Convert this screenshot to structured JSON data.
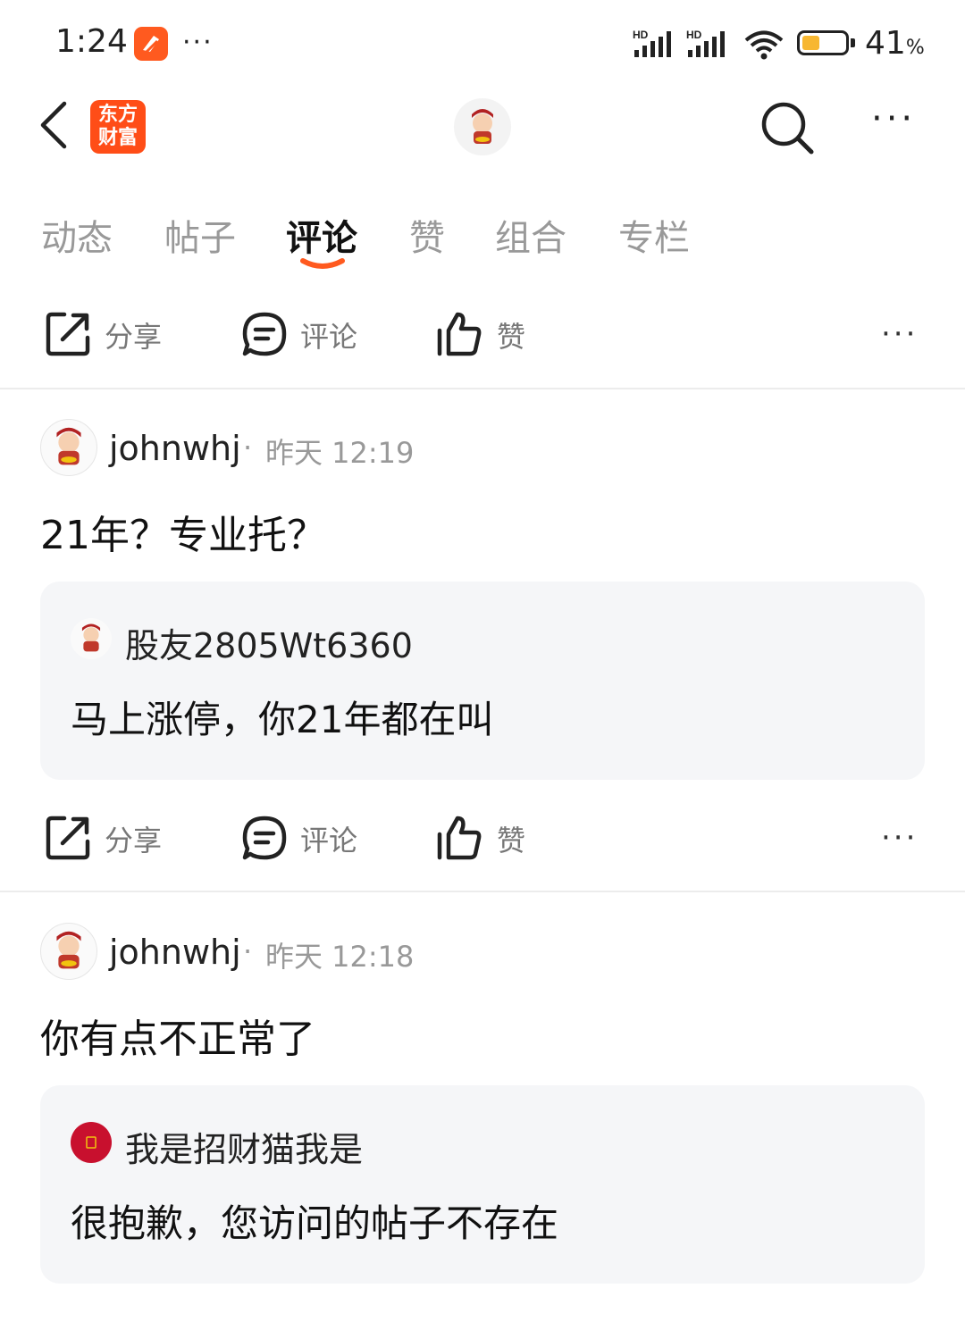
{
  "status_bar": {
    "time": "1:24",
    "more": "···",
    "battery_percent": "41",
    "battery_unit": "%",
    "battery_level": 0.41,
    "signal_label": "HD"
  },
  "header": {
    "logo_line1": "东方",
    "logo_line2": "财富",
    "more": "···"
  },
  "tabs": [
    {
      "label": "动态"
    },
    {
      "label": "帖子"
    },
    {
      "label": "评论",
      "active": true
    },
    {
      "label": "赞"
    },
    {
      "label": "组合"
    },
    {
      "label": "专栏"
    }
  ],
  "actions": {
    "share": "分享",
    "comment": "评论",
    "like": "赞",
    "more": "···"
  },
  "comments": [
    {
      "user": "johnwhj",
      "separator": "·",
      "time": "昨天 12:19",
      "content": "21年？专业托？",
      "quote": {
        "user": "股友2805Wt6360",
        "text": "马上涨停，你21年都在叫"
      }
    },
    {
      "user": "johnwhj",
      "separator": "·",
      "time": "昨天 12:18",
      "content": "你有点不正常了",
      "quote": {
        "user": "我是招财猫我是",
        "text": "很抱歉，您访问的帖子不存在"
      }
    }
  ],
  "colors": {
    "accent": "#ff5a1f",
    "quote_bg": "#f5f6f8",
    "muted": "#999999"
  }
}
